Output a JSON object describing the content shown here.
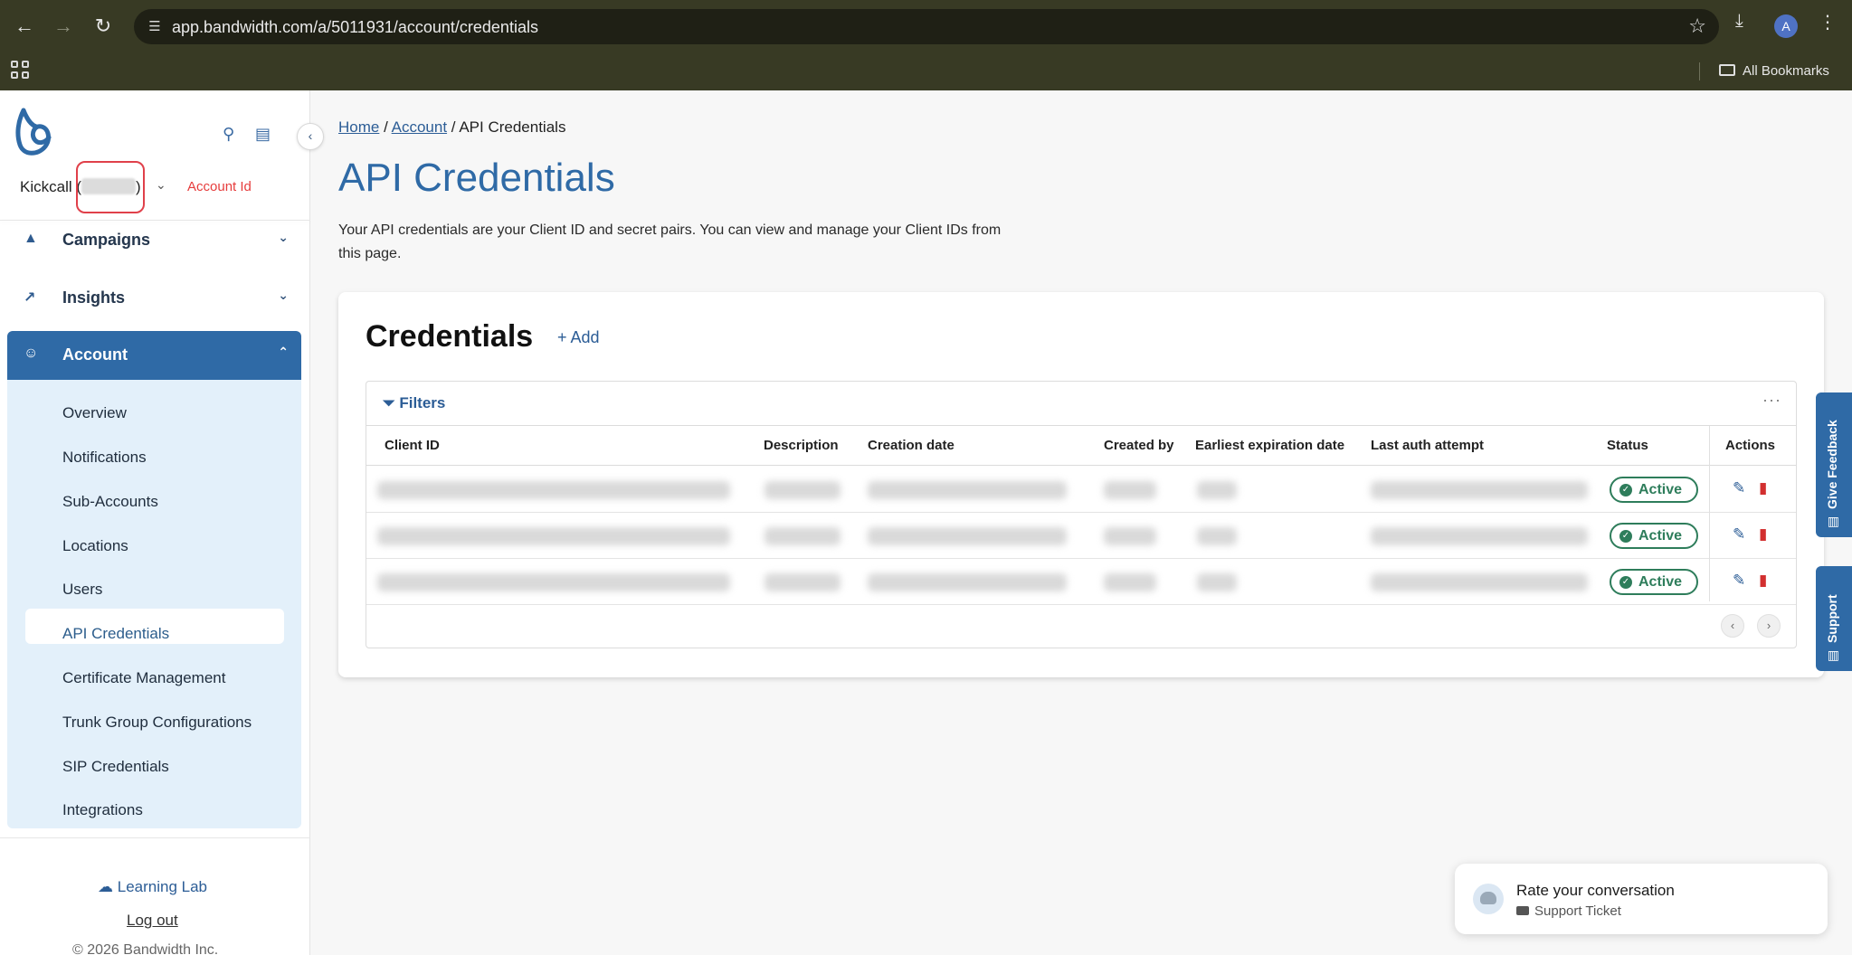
{
  "browser": {
    "url": "app.bandwidth.com/a/5011931/account/credentials",
    "profile_initial": "A",
    "bookmarks_label": "All Bookmarks"
  },
  "sidebar": {
    "account_name": "Kickcall (",
    "account_name_end": ")",
    "account_id_label": "Account Id",
    "nav": [
      {
        "label": "Campaigns"
      },
      {
        "label": "Insights"
      },
      {
        "label": "Account"
      }
    ],
    "account_items": [
      {
        "label": "Overview"
      },
      {
        "label": "Notifications"
      },
      {
        "label": "Sub-Accounts"
      },
      {
        "label": "Locations"
      },
      {
        "label": "Users"
      },
      {
        "label": "API Credentials"
      },
      {
        "label": "Certificate Management"
      },
      {
        "label": "Trunk Group Configurations"
      },
      {
        "label": "SIP Credentials"
      },
      {
        "label": "Integrations"
      }
    ],
    "learning_lab": "Learning Lab",
    "logout": "Log out",
    "copyright": "© 2026 Bandwidth Inc."
  },
  "breadcrumb": {
    "home": "Home",
    "sep": "/",
    "account": "Account",
    "current": "API Credentials"
  },
  "page": {
    "title": "API Credentials",
    "description": "Your API credentials are your Client ID and secret pairs. You can view and manage your Client IDs from this page."
  },
  "credentials": {
    "title": "Credentials",
    "add_label": "+ Add",
    "filters_label": "Filters",
    "columns": [
      "Client ID",
      "Description",
      "Creation date",
      "Created by",
      "Earliest expiration date",
      "Last auth attempt",
      "Status",
      "Actions"
    ],
    "rows": [
      {
        "status": "Active"
      },
      {
        "status": "Active"
      },
      {
        "status": "Active"
      }
    ]
  },
  "side_tabs": {
    "feedback": "Give Feedback",
    "support": "Support"
  },
  "toast": {
    "title": "Rate your conversation",
    "subtitle": "Support Ticket"
  },
  "colors": {
    "brand": "#2f6aa6",
    "active_status": "#2e7d5b",
    "delete": "#d22f2f",
    "browser_chrome": "#383a24"
  }
}
